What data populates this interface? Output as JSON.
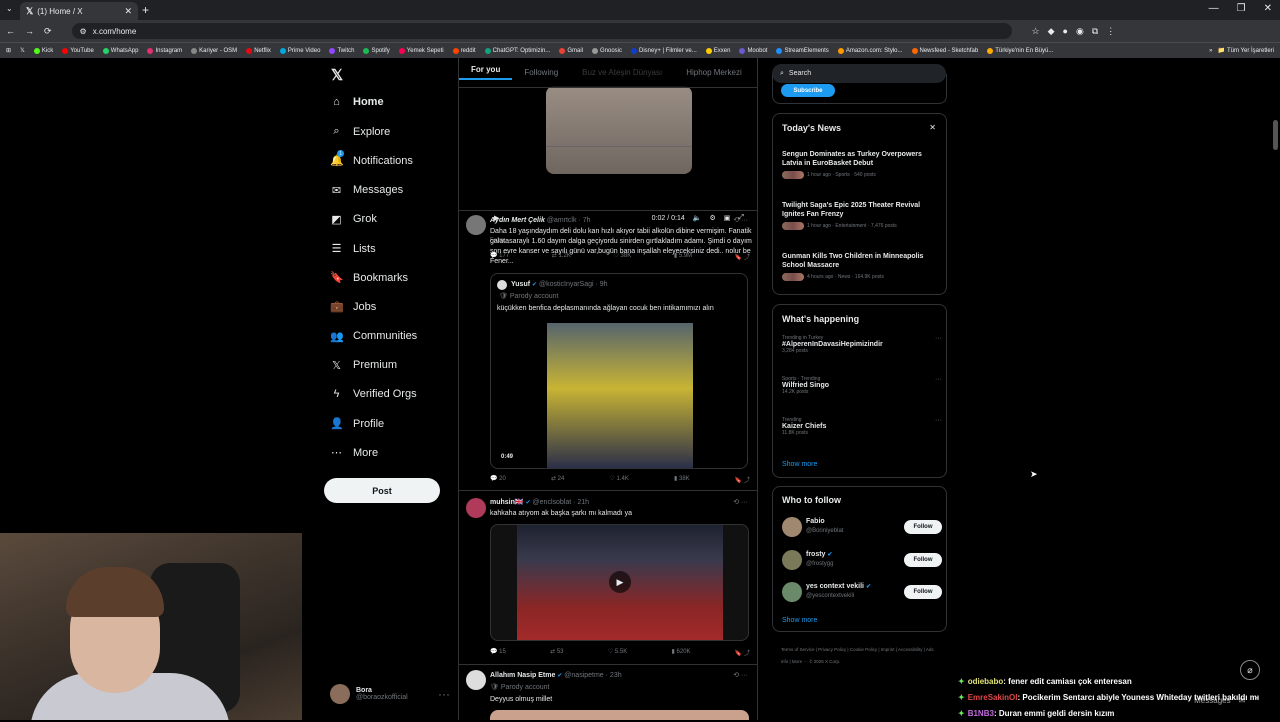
{
  "browser": {
    "tab_title": "(1) Home / X",
    "url": "x.com/home",
    "bookmarks": [
      "Kick",
      "YouTube",
      "WhatsApp",
      "Instagram",
      "Kariyer - OSM",
      "Netflix",
      "Prime Video",
      "Twitch",
      "Spotify",
      "Yemek Sepeti",
      "reddit",
      "ChatGPT: Optimizin...",
      "Gmail",
      "Gnoosic",
      "Disney+ | Filmler ve...",
      "Exxen",
      "Moobot",
      "StreamElements",
      "Amazon.com: Stylo...",
      "Newsfeed - Sketchfab",
      "Türkiye'nin En Büyü..."
    ],
    "bookmarks_right": "Tüm Yer İşaretleri"
  },
  "nav": {
    "items": [
      {
        "label": "Home",
        "icon": "home-icon"
      },
      {
        "label": "Explore",
        "icon": "search-icon"
      },
      {
        "label": "Notifications",
        "icon": "bell-icon"
      },
      {
        "label": "Messages",
        "icon": "mail-icon"
      },
      {
        "label": "Grok",
        "icon": "grok-icon"
      },
      {
        "label": "Lists",
        "icon": "list-icon"
      },
      {
        "label": "Bookmarks",
        "icon": "bookmark-icon"
      },
      {
        "label": "Jobs",
        "icon": "briefcase-icon"
      },
      {
        "label": "Communities",
        "icon": "people-icon"
      },
      {
        "label": "Premium",
        "icon": "x-icon"
      },
      {
        "label": "Verified Orgs",
        "icon": "lightning-icon"
      },
      {
        "label": "Profile",
        "icon": "person-icon"
      },
      {
        "label": "More",
        "icon": "more-circle-icon"
      }
    ],
    "notification_badge": "1",
    "post_label": "Post",
    "profile_name": "Bora",
    "profile_handle": "@boraozkofficial"
  },
  "feed": {
    "tabs": [
      "For you",
      "Following",
      "Buz ve Ateşin Dünyası",
      "Hiphop Merkezi"
    ],
    "video1": {
      "time": "0:02 / 0:14",
      "from": "From",
      "replies": "177",
      "retweets": "1.2K",
      "likes": "38K",
      "views": "5.9M"
    },
    "tweet2": {
      "name": "Aydın Mert Çelik",
      "handle": "@amrtclk · 7h",
      "text": "Daha 18 yaşındaydım deli dolu kan hızlı akıyor tabii alkolün dibine vermişim. Fanatik galatasaraylı 1.60 dayım dalga geçiyordu sinirden gırtlakladım adamı. Şimdi o dayım son evre kanser ve sayılı günü var,bugün bana inşallah eleyeceksiniz dedi.. nolur be Fener...",
      "quote_name": "Yusuf",
      "quote_handle": "@kosticInyarSagi · 9h",
      "quote_tag": "Parody account",
      "quote_text": "küçükken benfica deplasmanında ağlayan cocuk ben intikamımızı alın",
      "video_time": "0:49",
      "replies": "20",
      "retweets": "24",
      "likes": "1.4K",
      "views": "38K"
    },
    "tweet3": {
      "name": "muhsin🇬🇧",
      "handle": "@enclsoblat · 21h",
      "text": "kahkaha atıyom ak başka şarkı mı kalmadı ya",
      "replies": "15",
      "retweets": "53",
      "likes": "5.5K",
      "views": "620K"
    },
    "tweet4": {
      "name": "Allahım Nasip Etme",
      "handle": "@nasipetme · 23h",
      "tag": "Parody account",
      "text": "Deyyus olmuş millet"
    }
  },
  "right": {
    "search_placeholder": "Search",
    "subscribe": "Subscribe",
    "news_title": "Today's News",
    "news": [
      {
        "headline": "Sengun Dominates as Turkey Overpowers Latvia in EuroBasket Debut",
        "meta": "1 hour ago · Sports · 540 posts"
      },
      {
        "headline": "Twilight Saga's Epic 2025 Theater Revival Ignites Fan Frenzy",
        "meta": "1 hour ago · Entertainment · 7,476 posts"
      },
      {
        "headline": "Gunman Kills Two Children in Minneapolis School Massacre",
        "meta": "4 hours ago · News · 164.9K posts"
      }
    ],
    "happening_title": "What's happening",
    "trends": [
      {
        "category": "Trending in Turkey",
        "title": "#AlperenInDavasiHepimizindir",
        "posts": "3,284 posts"
      },
      {
        "category": "Sports · Trending",
        "title": "Wilfried Singo",
        "posts": "14.2K posts"
      },
      {
        "category": "Trending",
        "title": "Kaizer Chiefs",
        "posts": "11.8K posts"
      }
    ],
    "show_more": "Show more",
    "follow_title": "Who to follow",
    "follow": [
      {
        "name": "Fabio",
        "handle": "@Boriniyeblat",
        "verified": false
      },
      {
        "name": "frosty",
        "handle": "@frostygg",
        "verified": true
      },
      {
        "name": "yes context vekili",
        "handle": "@yescontextvekili",
        "verified": true
      }
    ],
    "follow_label": "Follow",
    "footer": "Terms of Service  |  Privacy Policy  |  Cookie Policy  |  Imprint  |  Accessibility  |  Ads info  |  More ···  © 2025 X Corp."
  },
  "overlay": {
    "chat": [
      {
        "user": "odiebabo",
        "msg": ": fener edit camiası çok enteresan"
      },
      {
        "user": "EmreSakinOl",
        "msg": ": Pocikerim Sentarcı abiyle Youness Whiteday twitleri bakıldı mı"
      },
      {
        "user": "B1NB3",
        "msg": ": Duran emmi geldi dersin kızım"
      }
    ],
    "messages_label": "Messages"
  }
}
